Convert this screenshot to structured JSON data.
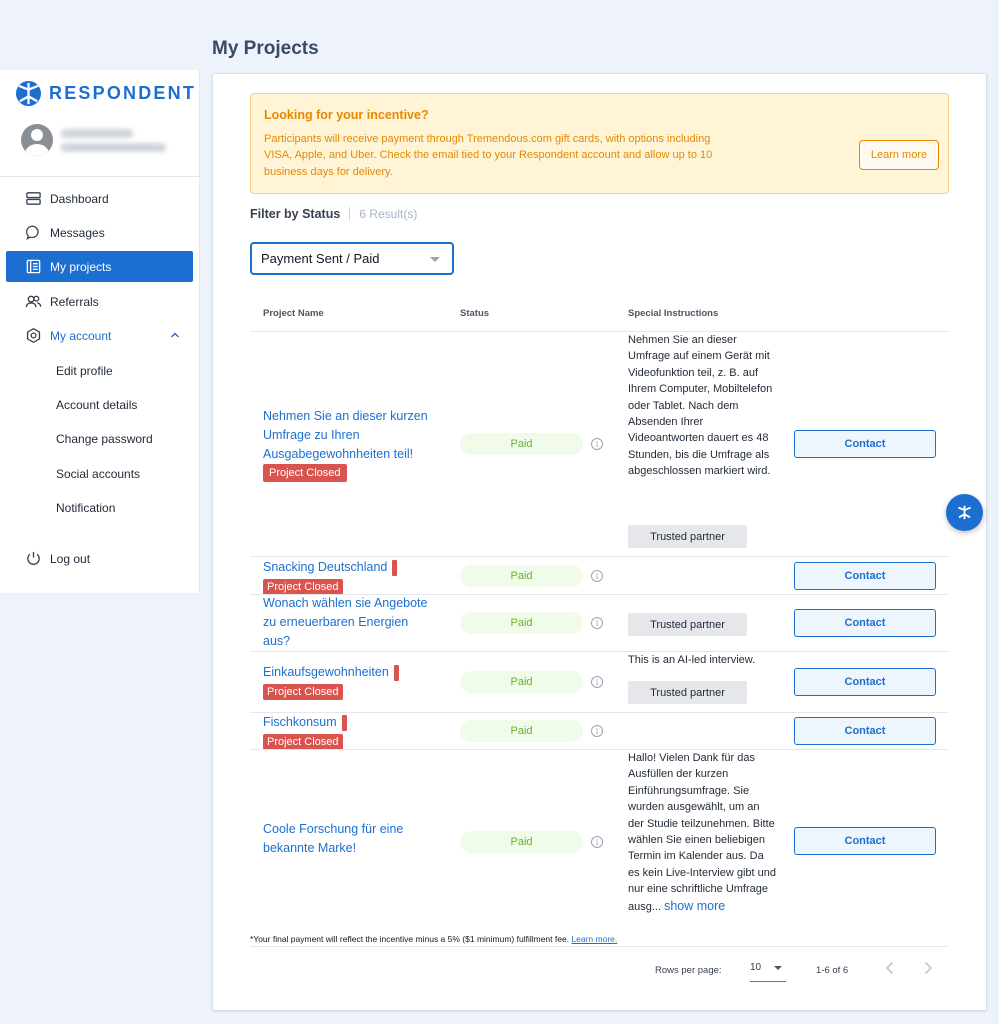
{
  "page": {
    "title": "My Projects"
  },
  "brand": {
    "name": "RESPONDENT",
    "color": "#1c6fd1"
  },
  "sidebar": {
    "items": [
      {
        "label": "Dashboard",
        "icon": "dashboard-icon"
      },
      {
        "label": "Messages",
        "icon": "chat-bubble-icon"
      },
      {
        "label": "My projects",
        "icon": "list-icon",
        "active": true
      },
      {
        "label": "Referrals",
        "icon": "people-icon"
      },
      {
        "label": "My account",
        "icon": "hexagon-settings-icon",
        "expanded": true
      }
    ],
    "account_subitems": [
      "Edit profile",
      "Account details",
      "Change password",
      "Social accounts",
      "Notification"
    ],
    "logout_label": "Log out"
  },
  "alert": {
    "title": "Looking for your incentive?",
    "body": "Participants will receive payment through Tremendous.com gift cards, with options including VISA, Apple, and Uber. Check the email tied to your Respondent account and allow up to 10 business days for delivery.",
    "button_label": "Learn more"
  },
  "filter": {
    "label": "Filter by Status",
    "count": "6 Result(s)",
    "selected": "Payment Sent / Paid"
  },
  "table": {
    "columns": [
      "Project Name",
      "Status",
      "Special Instructions"
    ],
    "contact_label": "Contact",
    "paid_label": "Paid",
    "closed_label": "Project Closed",
    "trusted_label": "Trusted partner",
    "info_glyph": "i",
    "rows": [
      {
        "name": "Nehmen Sie an dieser kurzen Umfrage zu Ihren Ausgabegewohnheiten teil!",
        "instructions": "Nehmen Sie an dieser Umfrage auf einem Gerät mit Videofunktion teil, z. B. auf Ihrem Computer, Mobiltelefon oder Tablet. Nach dem Absenden Ihrer Videoantworten dauert es 48 Stunden, bis die Umfrage als abgeschlossen markiert wird."
      },
      {
        "name": "Snacking Deutschland",
        "instructions": ""
      },
      {
        "name": "Wonach wählen sie Angebote zu erneuerbaren Energien aus?",
        "instructions": ""
      },
      {
        "name": "Einkaufsgewohnheiten",
        "instructions": "This is an AI-led interview."
      },
      {
        "name": "Fischkonsum",
        "instructions": ""
      },
      {
        "name": "Coole Forschung für eine bekannte Marke!",
        "instructions": "Hallo! Vielen Dank für das Ausfüllen der kurzen Einführungsumfrage. Sie wurden ausgewählt, um an der Studie teilzunehmen. Bitte wählen Sie einen beliebigen Termin im Kalender aus. Da es kein Live-Interview gibt und nur eine schriftliche Umfrage ausg...",
        "show_more": "show more"
      }
    ]
  },
  "footnote": {
    "text": "*Your final payment will reflect the incentive minus a 5% ($1 minimum) fulfillment fee.",
    "link": "Learn more."
  },
  "pagination": {
    "rows_per_page_label": "Rows per page:",
    "rows_per_page": "10",
    "range": "1-6 of 6"
  }
}
